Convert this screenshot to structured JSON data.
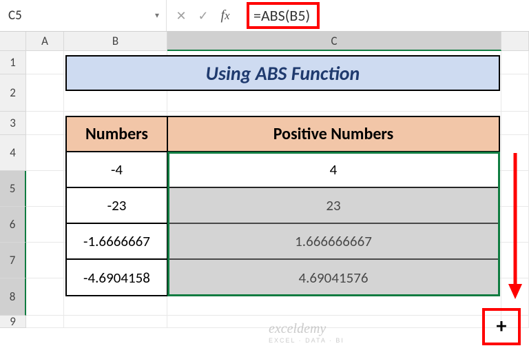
{
  "name_box": "C5",
  "formula": "=ABS(B5)",
  "columns": [
    "A",
    "B",
    "C"
  ],
  "rows_visible": [
    1,
    2,
    3,
    4,
    5,
    6,
    7,
    8,
    9
  ],
  "selected_rows": [
    5,
    6,
    7,
    8
  ],
  "title": "Using ABS Function",
  "table": {
    "headers": [
      "Numbers",
      "Positive Numbers"
    ],
    "rows": [
      {
        "number": "-4",
        "positive": "4"
      },
      {
        "number": "-23",
        "positive": "23"
      },
      {
        "number": "-1.6666667",
        "positive": "1.666666667"
      },
      {
        "number": "-4.6904158",
        "positive": "4.69041576"
      }
    ]
  },
  "watermark": {
    "main": "exceldemy",
    "sub": "EXCEL · DATA · BI"
  },
  "fill_cursor": "+"
}
